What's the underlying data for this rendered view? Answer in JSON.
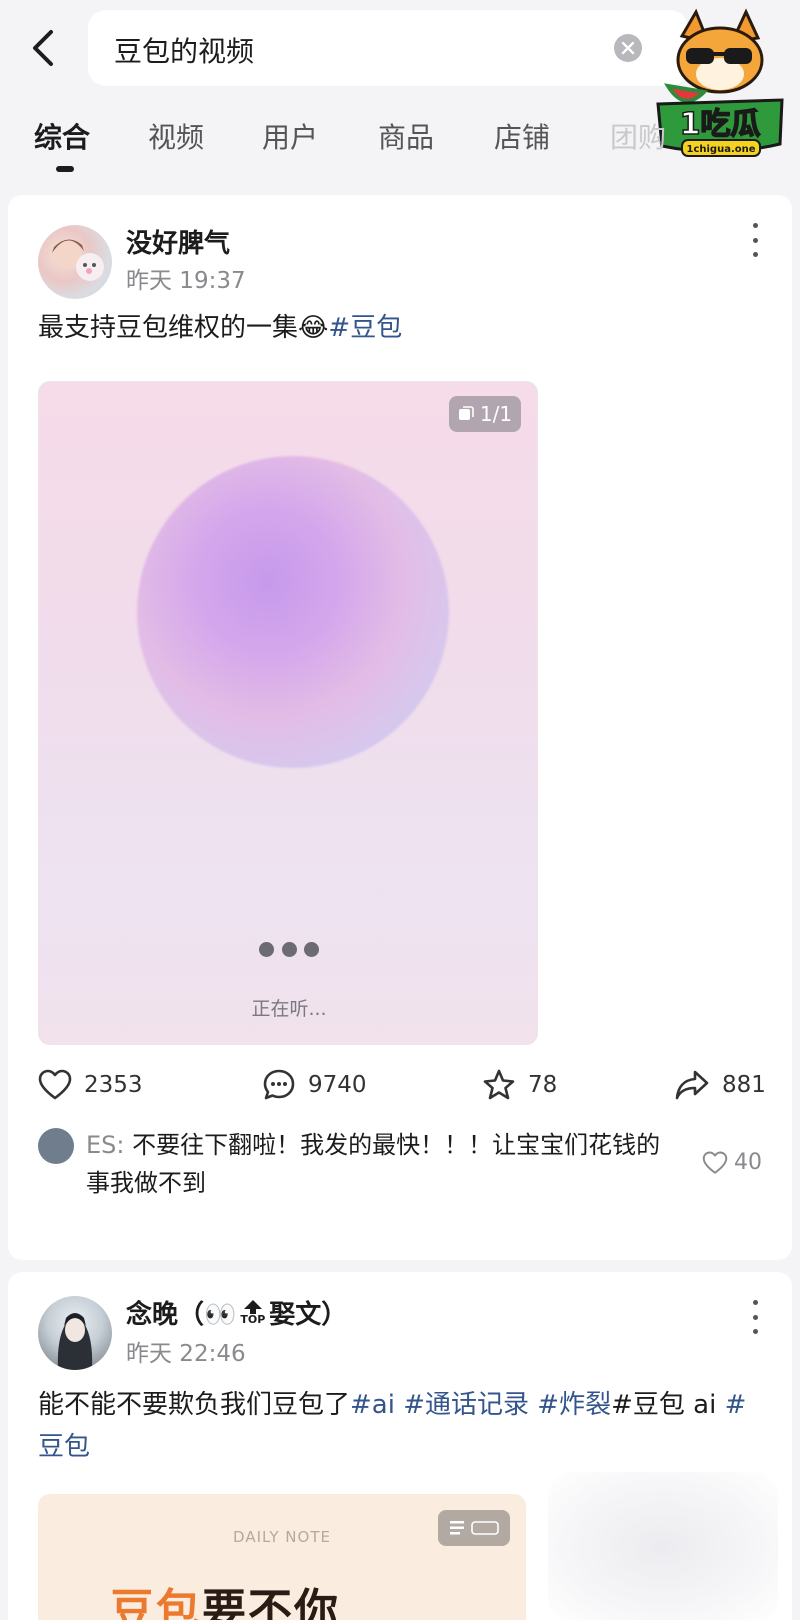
{
  "search": {
    "query": "豆包的视频"
  },
  "logo": {
    "text": "1吃瓜",
    "domain": "1chigua.one"
  },
  "tabs": [
    {
      "label": "综合",
      "active": true
    },
    {
      "label": "视频"
    },
    {
      "label": "用户"
    },
    {
      "label": "商品"
    },
    {
      "label": "店铺"
    },
    {
      "label": "团购"
    }
  ],
  "posts": [
    {
      "author": "没好脾气",
      "time": "昨天 19:37",
      "text": "最支持豆包维权的一集",
      "emoji": "😂",
      "hashtag": "#豆包",
      "media": {
        "page_badge": "1/1",
        "status_text": "正在听..."
      },
      "stats": {
        "likes": "2353",
        "comments": "9740",
        "favorites": "78",
        "shares": "881"
      },
      "top_comment": {
        "author": "ES:",
        "text": "不要往下翻啦！我发的最快！！！让宝宝们花钱的事我做不到",
        "likes": "40"
      }
    },
    {
      "author": "念晚（👀",
      "author_badge": "TOP",
      "author_suffix": "娶文）",
      "time": "昨天 22:46",
      "text": "能不能不要欺负我们豆包了",
      "hashtags": [
        "#ai",
        " #通话记录",
        " #炸裂"
      ],
      "text_tail": "#豆包 ai ",
      "hashtag_tail": "#豆包",
      "media": {
        "label": "DAILY NOTE",
        "headline_orange": "豆包",
        "headline_dark": "要不你"
      }
    }
  ],
  "colors": {
    "hashtag": "#33558c",
    "background": "#f4f4f6",
    "card": "#ffffff",
    "orb": "#c799ec"
  }
}
